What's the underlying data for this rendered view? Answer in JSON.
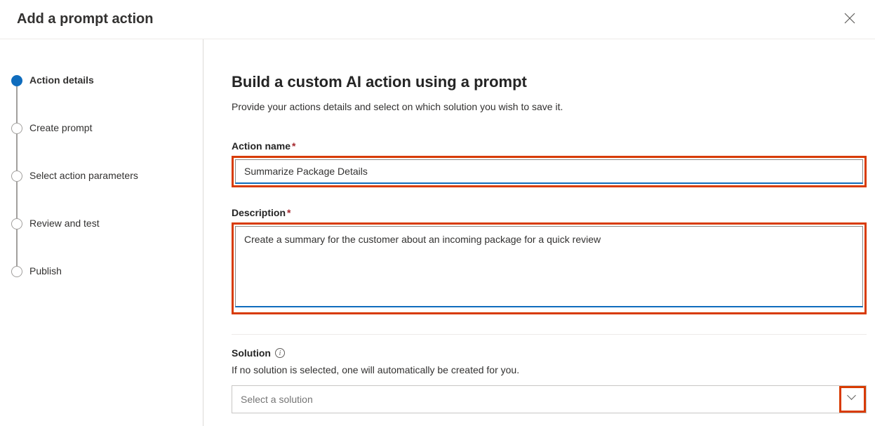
{
  "header": {
    "title": "Add a prompt action"
  },
  "sidebar": {
    "steps": [
      {
        "label": "Action details",
        "active": true
      },
      {
        "label": "Create prompt",
        "active": false
      },
      {
        "label": "Select action parameters",
        "active": false
      },
      {
        "label": "Review and test",
        "active": false
      },
      {
        "label": "Publish",
        "active": false
      }
    ]
  },
  "main": {
    "title": "Build a custom AI action using a prompt",
    "subheading": "Provide your actions details and select on which solution you wish to save it.",
    "action_name_label": "Action name",
    "action_name_value": "Summarize Package Details",
    "description_label": "Description",
    "description_value": "Create a summary for the customer about an incoming package for a quick review",
    "solution_label": "Solution",
    "solution_hint": "If no solution is selected, one will automatically be created for you.",
    "solution_placeholder": "Select a solution"
  },
  "icons": {
    "close": "close-icon",
    "info": "info-icon",
    "chevron": "chevron-down-icon"
  },
  "highlight_color": "#d83b01"
}
